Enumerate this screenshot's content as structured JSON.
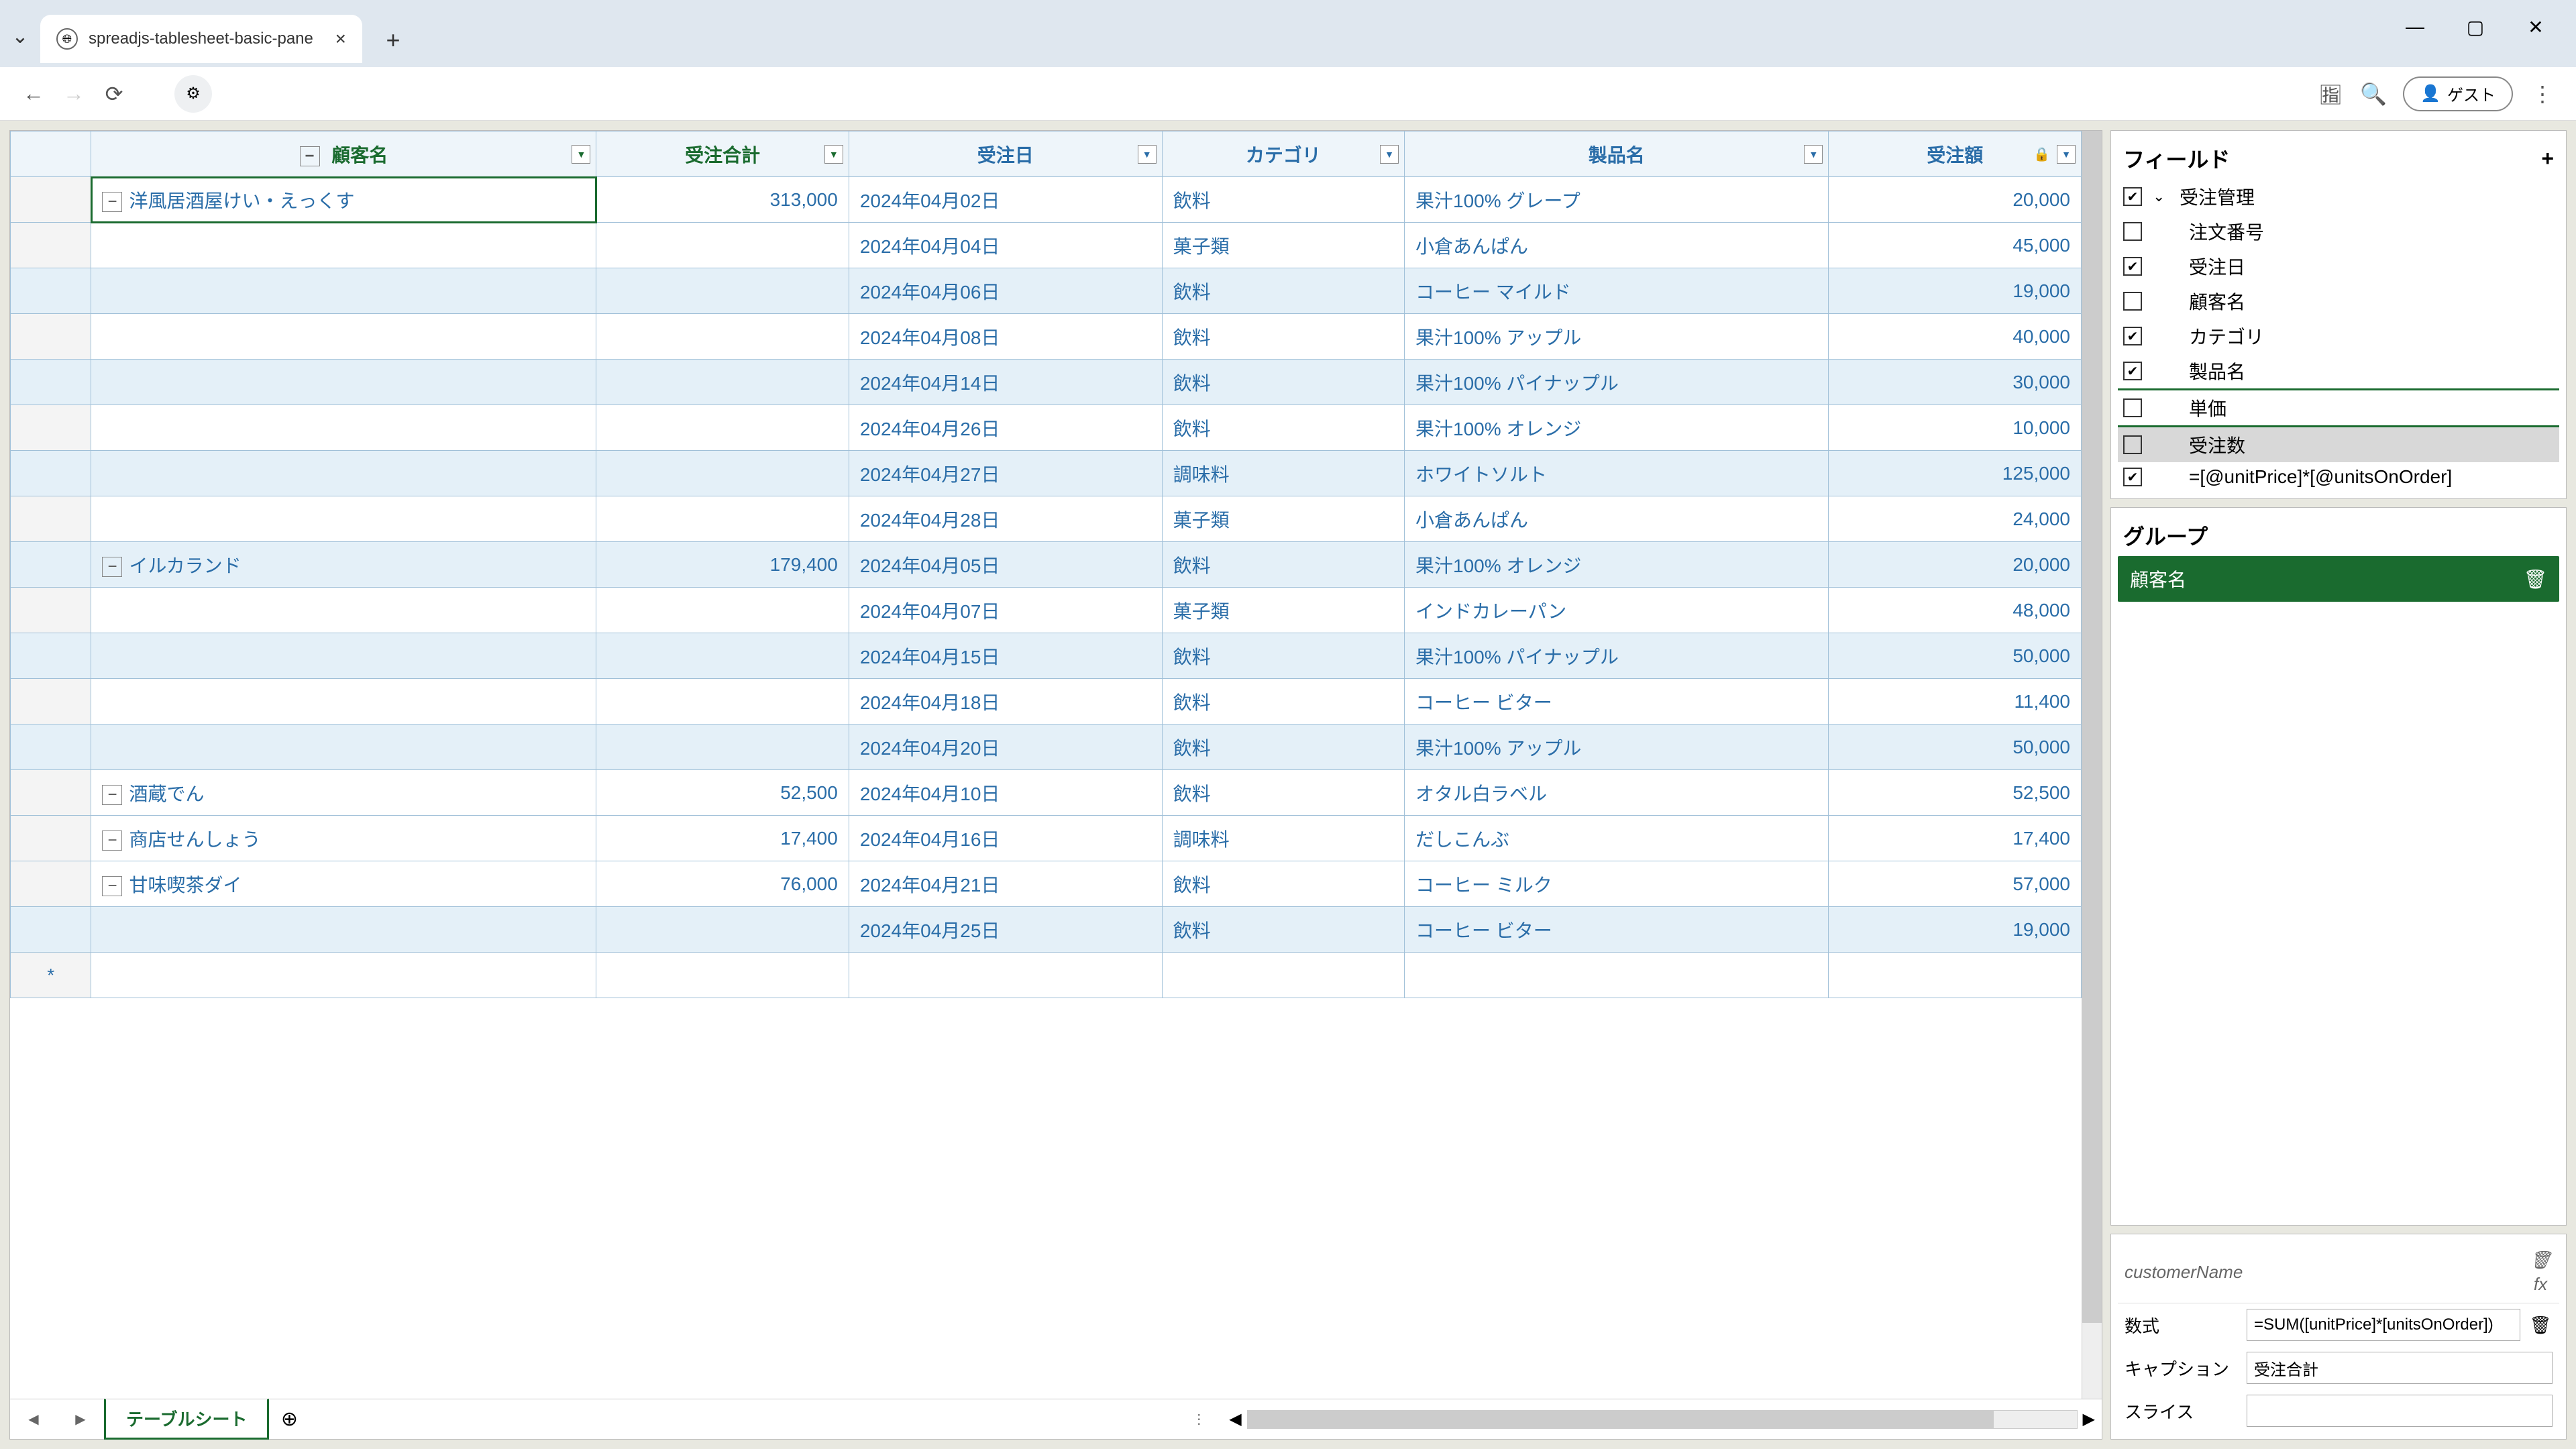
{
  "browser": {
    "tab_title": "spreadjs-tablesheet-basic-pane",
    "guest_label": "ゲスト"
  },
  "columns": {
    "customer": "顧客名",
    "order_total": "受注合計",
    "order_date": "受注日",
    "category": "カテゴリ",
    "product": "製品名",
    "amount": "受注額"
  },
  "groups": [
    {
      "customer": "洋風居酒屋けい・えっくす",
      "total": "313,000",
      "rows": [
        {
          "date": "2024年04月02日",
          "cat": "飲料",
          "prod": "果汁100% グレープ",
          "amt": "20,000",
          "alt": false
        },
        {
          "date": "2024年04月04日",
          "cat": "菓子類",
          "prod": "小倉あんぱん",
          "amt": "45,000",
          "alt": false
        },
        {
          "date": "2024年04月06日",
          "cat": "飲料",
          "prod": "コーヒー マイルド",
          "amt": "19,000",
          "alt": true
        },
        {
          "date": "2024年04月08日",
          "cat": "飲料",
          "prod": "果汁100% アップル",
          "amt": "40,000",
          "alt": false
        },
        {
          "date": "2024年04月14日",
          "cat": "飲料",
          "prod": "果汁100% パイナップル",
          "amt": "30,000",
          "alt": true
        },
        {
          "date": "2024年04月26日",
          "cat": "飲料",
          "prod": "果汁100% オレンジ",
          "amt": "10,000",
          "alt": false
        },
        {
          "date": "2024年04月27日",
          "cat": "調味料",
          "prod": "ホワイトソルト",
          "amt": "125,000",
          "alt": true
        },
        {
          "date": "2024年04月28日",
          "cat": "菓子類",
          "prod": "小倉あんぱん",
          "amt": "24,000",
          "alt": false
        }
      ]
    },
    {
      "customer": "イルカランド",
      "total": "179,400",
      "rows": [
        {
          "date": "2024年04月05日",
          "cat": "飲料",
          "prod": "果汁100% オレンジ",
          "amt": "20,000",
          "alt": true
        },
        {
          "date": "2024年04月07日",
          "cat": "菓子類",
          "prod": "インドカレーパン",
          "amt": "48,000",
          "alt": false
        },
        {
          "date": "2024年04月15日",
          "cat": "飲料",
          "prod": "果汁100% パイナップル",
          "amt": "50,000",
          "alt": true
        },
        {
          "date": "2024年04月18日",
          "cat": "飲料",
          "prod": "コーヒー ビター",
          "amt": "11,400",
          "alt": false
        },
        {
          "date": "2024年04月20日",
          "cat": "飲料",
          "prod": "果汁100% アップル",
          "amt": "50,000",
          "alt": true
        }
      ]
    },
    {
      "customer": "酒蔵でん",
      "total": "52,500",
      "rows": [
        {
          "date": "2024年04月10日",
          "cat": "飲料",
          "prod": "オタル白ラベル",
          "amt": "52,500",
          "alt": false
        }
      ]
    },
    {
      "customer": "商店せんしょう",
      "total": "17,400",
      "rows": [
        {
          "date": "2024年04月16日",
          "cat": "調味料",
          "prod": "だしこんぶ",
          "amt": "17,400",
          "alt": false
        }
      ]
    },
    {
      "customer": "甘味喫茶ダイ",
      "total": "76,000",
      "rows": [
        {
          "date": "2024年04月21日",
          "cat": "飲料",
          "prod": "コーヒー ミルク",
          "amt": "57,000",
          "alt": false
        },
        {
          "date": "2024年04月25日",
          "cat": "飲料",
          "prod": "コーヒー ビター",
          "amt": "19,000",
          "alt": true
        }
      ]
    }
  ],
  "sheet_tab": "テーブルシート",
  "fields_panel": {
    "title": "フィールド",
    "root": "受注管理",
    "items": [
      {
        "label": "注文番号",
        "checked": false
      },
      {
        "label": "受注日",
        "checked": true
      },
      {
        "label": "顧客名",
        "checked": false
      },
      {
        "label": "カテゴリ",
        "checked": true
      },
      {
        "label": "製品名",
        "checked": true
      },
      {
        "label": "単価",
        "checked": false
      },
      {
        "label": "受注数",
        "checked": false,
        "hl": true
      },
      {
        "label": "=[@unitPrice]*[@unitsOnOrder]",
        "checked": true
      }
    ]
  },
  "group_panel": {
    "title": "グループ",
    "chip": "顧客名"
  },
  "config_panel": {
    "name": "customerName",
    "rows": {
      "formula_label": "数式",
      "formula_value": "=SUM([unitPrice]*[unitsOnOrder])",
      "caption_label": "キャプション",
      "caption_value": "受注合計",
      "slice_label": "スライス",
      "slice_value": ""
    }
  }
}
